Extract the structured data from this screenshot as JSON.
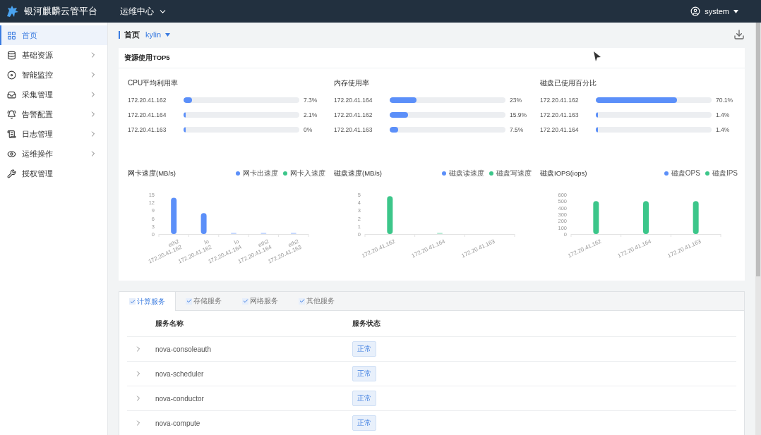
{
  "header": {
    "title": "银河麒麟云管平台",
    "menu": "运维中心",
    "user": "system"
  },
  "sidebar": {
    "items": [
      {
        "label": "首页",
        "selected": true,
        "expandable": false
      },
      {
        "label": "基础资源",
        "selected": false,
        "expandable": true
      },
      {
        "label": "智能监控",
        "selected": false,
        "expandable": true
      },
      {
        "label": "采集管理",
        "selected": false,
        "expandable": true
      },
      {
        "label": "告警配置",
        "selected": false,
        "expandable": true
      },
      {
        "label": "日志管理",
        "selected": false,
        "expandable": true
      },
      {
        "label": "运维操作",
        "selected": false,
        "expandable": true
      },
      {
        "label": "授权管理",
        "selected": false,
        "expandable": false
      }
    ]
  },
  "breadcrumb": {
    "title": "首页",
    "project": "kylin"
  },
  "top5": {
    "title": "资源使用TOP5",
    "groups": [
      {
        "title": "CPU平均利用率",
        "rows": [
          {
            "host": "172.20.41.162",
            "level": 0.073,
            "reading": "7.3%"
          },
          {
            "host": "172.20.41.164",
            "level": 0.021,
            "reading": "2.1%"
          },
          {
            "host": "172.20.41.163",
            "level": 0,
            "reading": "0%"
          }
        ]
      },
      {
        "title": "内存使用率",
        "rows": [
          {
            "host": "172.20.41.164",
            "level": 0.23,
            "reading": "23%"
          },
          {
            "host": "172.20.41.162",
            "level": 0.159,
            "reading": "15.9%"
          },
          {
            "host": "172.20.41.163",
            "level": 0.075,
            "reading": "7.5%"
          }
        ]
      },
      {
        "title": "磁盘已使用百分比",
        "rows": [
          {
            "host": "172.20.41.162",
            "level": 0.701,
            "reading": "70.1%"
          },
          {
            "host": "172.20.41.163",
            "level": 0.014,
            "reading": "1.4%"
          },
          {
            "host": "172.20.41.164",
            "level": 0.014,
            "reading": "1.4%"
          }
        ]
      }
    ]
  },
  "charts": [
    {
      "chart_data": {
        "type": "bar",
        "title": "网卡速度(MB/s)",
        "categories": [
          "eth2\n172.20.41.162",
          "lo\n172.20.41.162",
          "lo\n172.20.41.164",
          "eth2\n172.20.41.164",
          "eth2\n172.20.41.163"
        ],
        "series": [
          {
            "name": "网卡出速度",
            "color": "#5b8ff9",
            "values": [
              13.8,
              8,
              0.1,
              0.1,
              0.1
            ]
          },
          {
            "name": "网卡入速度",
            "color": "#3cc68a",
            "values": [
              0,
              0,
              0,
              0,
              0
            ]
          }
        ],
        "ylim": [
          0,
          15
        ],
        "yticks": [
          0,
          3,
          6,
          9,
          12,
          15
        ]
      }
    },
    {
      "chart_data": {
        "type": "bar",
        "title": "磁盘速度(MB/s)",
        "categories": [
          "172.20.41.162",
          "172.20.41.164",
          "172.20.41.163"
        ],
        "series": [
          {
            "name": "磁盘读速度",
            "color": "#5b8ff9",
            "values": [
              0,
              0,
              0
            ]
          },
          {
            "name": "磁盘写速度",
            "color": "#3cc68a",
            "values": [
              4.8,
              0.1,
              0
            ]
          }
        ],
        "ylim": [
          0,
          5
        ],
        "yticks": [
          0,
          1,
          2,
          3,
          4,
          5
        ]
      }
    },
    {
      "chart_data": {
        "type": "bar",
        "title": "磁盘IOPS(iops)",
        "categories": [
          "172.20.41.162",
          "172.20.41.164",
          "172.20.41.163"
        ],
        "series": [
          {
            "name": "磁盘OPS",
            "color": "#5b8ff9",
            "values": [
              0,
              0,
              0
            ]
          },
          {
            "name": "磁盘IPS",
            "color": "#3cc68a",
            "values": [
              500,
              500,
              500
            ]
          }
        ],
        "ylim": [
          0,
          600
        ],
        "yticks": [
          0,
          100,
          200,
          300,
          400,
          500,
          600
        ]
      }
    }
  ],
  "services": {
    "tabs": [
      {
        "label": "计算服务",
        "selected": true
      },
      {
        "label": "存储服务",
        "selected": false
      },
      {
        "label": "网络服务",
        "selected": false
      },
      {
        "label": "其他服务",
        "selected": false
      }
    ],
    "columns": [
      "服务名称",
      "服务状态"
    ],
    "rows": [
      {
        "name": "nova-consoleauth",
        "status": "正常"
      },
      {
        "name": "nova-scheduler",
        "status": "正常"
      },
      {
        "name": "nova-conductor",
        "status": "正常"
      },
      {
        "name": "nova-compute",
        "status": "正常"
      }
    ]
  }
}
